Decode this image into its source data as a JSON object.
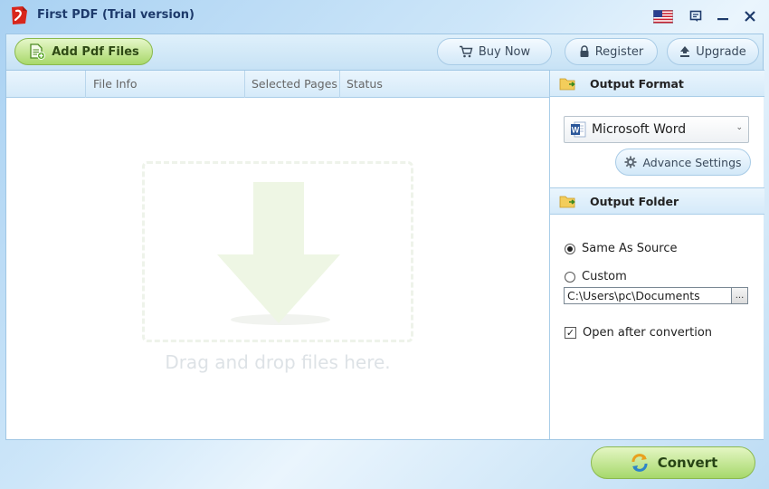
{
  "window": {
    "title": "First PDF (Trial version)",
    "drop_hint": "Drag and drop files here."
  },
  "toolbar": {
    "add_files": "Add Pdf Files",
    "buy_now": "Buy Now",
    "register": "Register",
    "upgrade": "Upgrade"
  },
  "file_table": {
    "columns": [
      "",
      "File Info",
      "Selected Pages",
      "Status"
    ]
  },
  "output_format": {
    "header": "Output Format",
    "selected": "Microsoft Word",
    "advance_settings": "Advance Settings"
  },
  "output_folder": {
    "header": "Output Folder",
    "same_as_source": "Same As Source",
    "custom": "Custom",
    "path": "C:\\Users\\pc\\Documents",
    "browse": "...",
    "open_after": "Open after convertion",
    "same_as_source_selected": true,
    "open_after_checked": true
  },
  "actions": {
    "convert": "Convert"
  },
  "colors": {
    "accent_green": "#a6d86b",
    "header_blue": "#d5eaf9",
    "title_text": "#1d3a6b"
  }
}
